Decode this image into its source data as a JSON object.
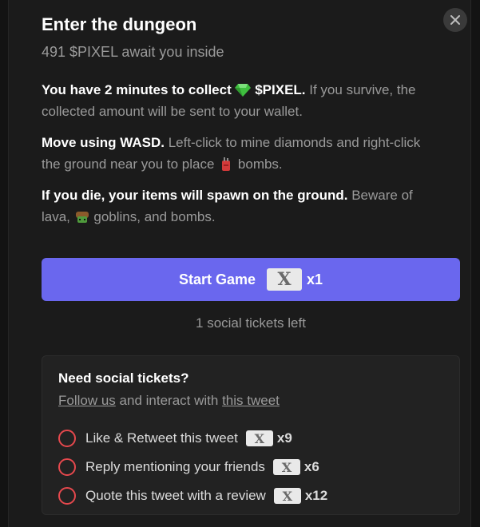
{
  "modal": {
    "title": "Enter the dungeon",
    "subtitle": "491 $PIXEL await you inside",
    "close_icon": "close-icon"
  },
  "instructions": {
    "p1_highlight_a": "You have 2 minutes to collect",
    "p1_highlight_b": "$PIXEL.",
    "p1_rest": "If you survive, the collected amount will be sent to your wallet.",
    "p2_highlight": "Move using WASD.",
    "p2_rest_a": "Left-click to mine diamonds and right-click the ground near you to place",
    "p2_rest_b": "bombs.",
    "p3_highlight": "If you die, your items will spawn on the ground.",
    "p3_rest_a": "Beware of lava,",
    "p3_rest_b": "goblins, and bombs.",
    "icons": [
      "diamond-icon",
      "bomb-icon",
      "goblin-icon"
    ]
  },
  "start": {
    "label": "Start Game",
    "ticket_icon": "X",
    "count": "x1"
  },
  "tickets_left": "1 social tickets left",
  "social": {
    "title": "Need social tickets?",
    "follow_link": "Follow us",
    "middle": "and interact with",
    "tweet_link": "this tweet",
    "tasks": [
      {
        "label": "Like & Retweet this tweet",
        "ticket": "X",
        "mult": "x9"
      },
      {
        "label": "Reply mentioning your friends",
        "ticket": "X",
        "mult": "x6"
      },
      {
        "label": "Quote this tweet with a review",
        "ticket": "X",
        "mult": "x12"
      }
    ]
  },
  "colors": {
    "accent": "#6a67ee",
    "radio": "#e5484d",
    "background": "#1b1b1b",
    "muted_text": "#9a9a9a"
  }
}
